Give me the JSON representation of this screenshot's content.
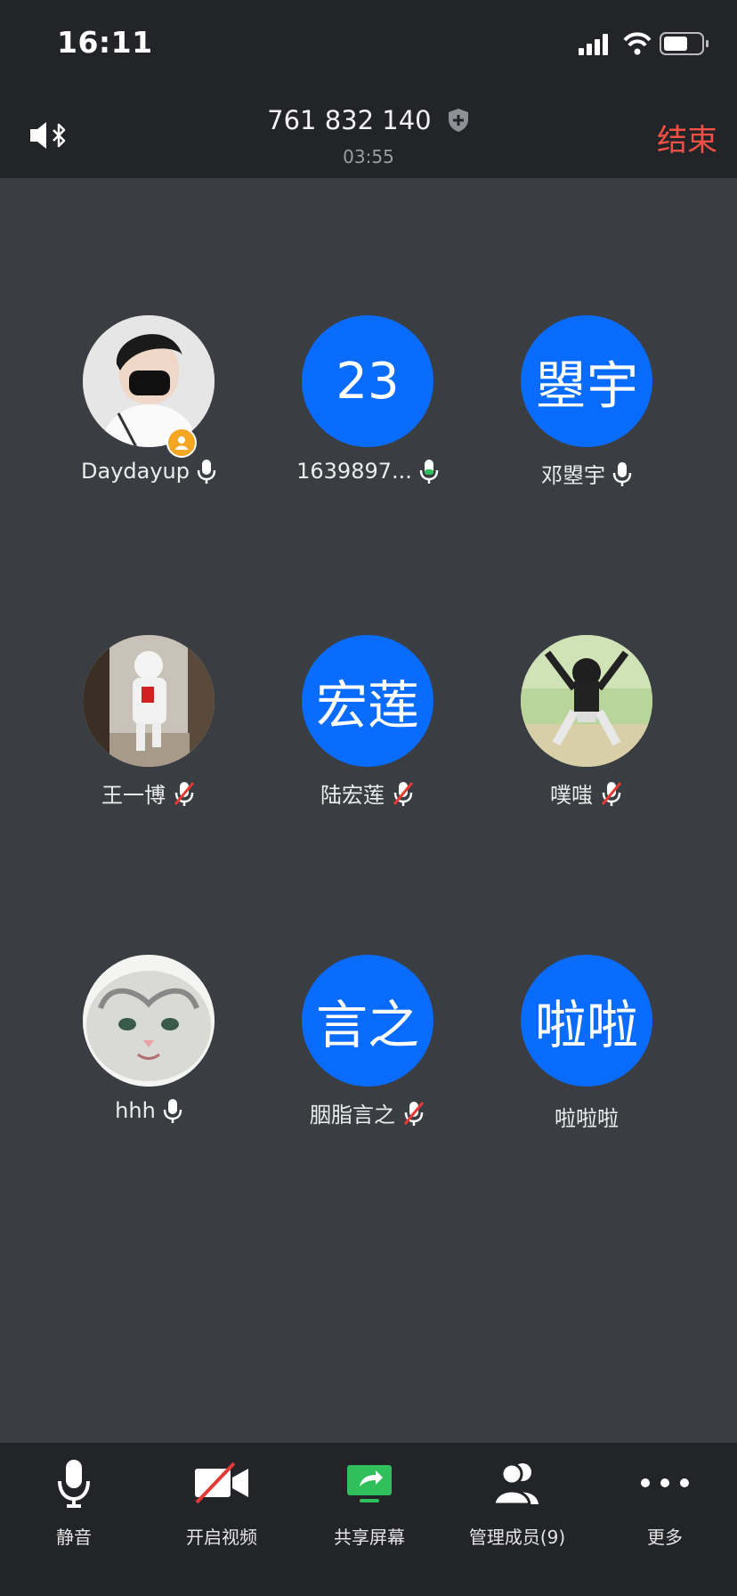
{
  "status_bar": {
    "time": "16:11"
  },
  "header": {
    "meeting_id": "761 832 140",
    "duration": "03:55",
    "end_label": "结束"
  },
  "participants": [
    {
      "name": "Daydayup",
      "avatar_type": "photo",
      "mic": "on",
      "host": true
    },
    {
      "name": "1639897...",
      "avatar_text": "23",
      "avatar_type": "text",
      "mic": "on-active"
    },
    {
      "name": "邓曌宇",
      "avatar_text": "曌宇",
      "avatar_type": "text",
      "mic": "on"
    },
    {
      "name": "王一博",
      "avatar_type": "photo",
      "mic": "muted"
    },
    {
      "name": "陆宏莲",
      "avatar_text": "宏莲",
      "avatar_type": "text",
      "mic": "muted"
    },
    {
      "name": "噗嗤",
      "avatar_type": "photo",
      "mic": "muted"
    },
    {
      "name": "hhh",
      "avatar_type": "photo",
      "mic": "on"
    },
    {
      "name": "胭脂言之",
      "avatar_text": "言之",
      "avatar_type": "text",
      "mic": "muted"
    },
    {
      "name": "啦啦啦",
      "avatar_text": "啦啦",
      "avatar_type": "text",
      "mic": "none"
    }
  ],
  "toolbar": {
    "mute_label": "静音",
    "video_label": "开启视频",
    "share_label": "共享屏幕",
    "members_label": "管理成员(9)",
    "more_label": "更多"
  },
  "colors": {
    "avatar_blue": "#0a6cff",
    "end_red": "#f05045",
    "share_green": "#2fbf5b",
    "host_orange": "#f5a623"
  }
}
